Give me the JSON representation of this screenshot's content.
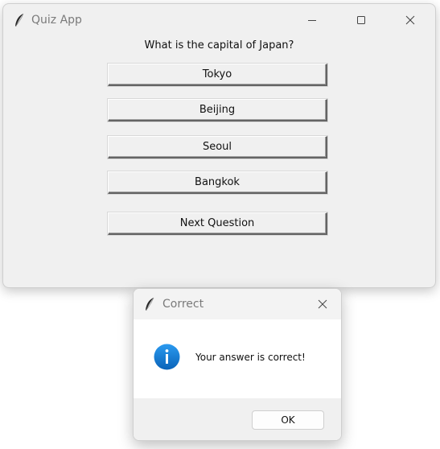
{
  "main_window": {
    "title": "Quiz App",
    "question": "What is the capital of Japan?",
    "answers": [
      "Tokyo",
      "Beijing",
      "Seoul",
      "Bangkok"
    ],
    "next_label": "Next Question"
  },
  "dialog": {
    "title": "Correct",
    "message": "Your answer is correct!",
    "ok_label": "OK",
    "icon": "info-icon"
  },
  "colors": {
    "window_bg": "#f0f0f0",
    "info_blue": "#1a7fd6"
  }
}
